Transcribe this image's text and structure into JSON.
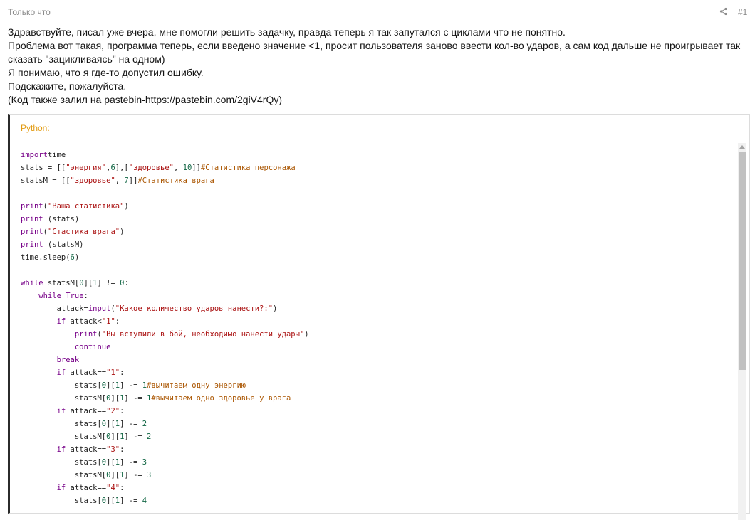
{
  "post": {
    "time": "Только что",
    "number": "#1",
    "paragraphs": [
      "Здравствуйте, писал уже вчера, мне помогли решить задачку, правда теперь я так запутался с циклами что не понятно.",
      "Проблема вот такая, программа теперь, если введено значение <1, просит пользователя заново ввести кол-во ударов, а сам код дальше не проигрывает так сказать \"зацикливаясь\" на одном)",
      "Я понимаю, что я где-то допустил ошибку.",
      "Подскажите, пожалуйста.",
      "(Код также залил на pastebin-https://pastebin.com/2giV4rQy)"
    ]
  },
  "code": {
    "language": "Python:",
    "lines": [
      [
        [
          "kw",
          "import"
        ],
        [
          "",
          "time"
        ]
      ],
      [
        [
          "",
          "stats = [["
        ],
        [
          "st",
          "\"энергия\""
        ],
        [
          "",
          ","
        ],
        [
          "nu",
          "6"
        ],
        [
          "",
          "],["
        ],
        [
          "st",
          "\"здоровье\""
        ],
        [
          "",
          ", "
        ],
        [
          "nu",
          "10"
        ],
        [
          "",
          "]]"
        ],
        [
          "cm",
          "#Статистика персонажа"
        ]
      ],
      [
        [
          "",
          "statsM = [["
        ],
        [
          "st",
          "\"здоровье\""
        ],
        [
          "",
          ", "
        ],
        [
          "nu",
          "7"
        ],
        [
          "",
          "]]"
        ],
        [
          "cm",
          "#Статистика врага"
        ]
      ],
      [],
      [
        [
          "kw",
          "print"
        ],
        [
          "",
          "("
        ],
        [
          "st",
          "\"Ваша статистика\""
        ],
        [
          "",
          ")"
        ]
      ],
      [
        [
          "kw",
          "print"
        ],
        [
          "",
          " (stats)"
        ]
      ],
      [
        [
          "kw",
          "print"
        ],
        [
          "",
          "("
        ],
        [
          "st",
          "\"Стастика врага\""
        ],
        [
          "",
          ")"
        ]
      ],
      [
        [
          "kw",
          "print"
        ],
        [
          "",
          " (statsM)"
        ]
      ],
      [
        [
          "",
          "time.sleep("
        ],
        [
          "nu",
          "6"
        ],
        [
          "",
          ")"
        ]
      ],
      [],
      [
        [
          "kw",
          "while"
        ],
        [
          "",
          " statsM["
        ],
        [
          "nu",
          "0"
        ],
        [
          "",
          "]["
        ],
        [
          "nu",
          "1"
        ],
        [
          "",
          "] != "
        ],
        [
          "nu",
          "0"
        ],
        [
          "",
          ":"
        ]
      ],
      [
        [
          "",
          "    "
        ],
        [
          "kw",
          "while"
        ],
        [
          "",
          ""
        ],
        [
          "kw",
          " True"
        ],
        [
          "",
          ":"
        ]
      ],
      [
        [
          "",
          "        attack="
        ],
        [
          "kw",
          "input"
        ],
        [
          "",
          "("
        ],
        [
          "st",
          "\"Какое количество ударов нанести?:\""
        ],
        [
          "",
          ")"
        ]
      ],
      [
        [
          "",
          "        "
        ],
        [
          "kw",
          "if"
        ],
        [
          "",
          " attack<"
        ],
        [
          "st",
          "\"1\""
        ],
        [
          "",
          ":"
        ]
      ],
      [
        [
          "",
          "            "
        ],
        [
          "kw",
          "print"
        ],
        [
          "",
          "("
        ],
        [
          "st",
          "\"Вы вступили в бой, необходимо нанести удары\""
        ],
        [
          "",
          ")"
        ]
      ],
      [
        [
          "",
          "            "
        ],
        [
          "kw",
          "continue"
        ]
      ],
      [
        [
          "",
          "        "
        ],
        [
          "kw",
          "break"
        ]
      ],
      [
        [
          "",
          "        "
        ],
        [
          "kw",
          "if"
        ],
        [
          "",
          " attack=="
        ],
        [
          "st",
          "\"1\""
        ],
        [
          "",
          ":"
        ]
      ],
      [
        [
          "",
          "            stats["
        ],
        [
          "nu",
          "0"
        ],
        [
          "",
          "]["
        ],
        [
          "nu",
          "1"
        ],
        [
          "",
          "] -= "
        ],
        [
          "nu",
          "1"
        ],
        [
          "cm",
          "#вычитаем одну энергию"
        ]
      ],
      [
        [
          "",
          "            statsM["
        ],
        [
          "nu",
          "0"
        ],
        [
          "",
          "]["
        ],
        [
          "nu",
          "1"
        ],
        [
          "",
          "] -= "
        ],
        [
          "nu",
          "1"
        ],
        [
          "cm",
          "#вычитаем одно здоровье у врага"
        ]
      ],
      [
        [
          "",
          "        "
        ],
        [
          "kw",
          "if"
        ],
        [
          "",
          " attack=="
        ],
        [
          "st",
          "\"2\""
        ],
        [
          "",
          ":"
        ]
      ],
      [
        [
          "",
          "            stats["
        ],
        [
          "nu",
          "0"
        ],
        [
          "",
          "]["
        ],
        [
          "nu",
          "1"
        ],
        [
          "",
          "] -= "
        ],
        [
          "nu",
          "2"
        ]
      ],
      [
        [
          "",
          "            statsM["
        ],
        [
          "nu",
          "0"
        ],
        [
          "",
          "]["
        ],
        [
          "nu",
          "1"
        ],
        [
          "",
          "] -= "
        ],
        [
          "nu",
          "2"
        ]
      ],
      [
        [
          "",
          "        "
        ],
        [
          "kw",
          "if"
        ],
        [
          "",
          " attack=="
        ],
        [
          "st",
          "\"3\""
        ],
        [
          "",
          ":"
        ]
      ],
      [
        [
          "",
          "            stats["
        ],
        [
          "nu",
          "0"
        ],
        [
          "",
          "]["
        ],
        [
          "nu",
          "1"
        ],
        [
          "",
          "] -= "
        ],
        [
          "nu",
          "3"
        ]
      ],
      [
        [
          "",
          "            statsM["
        ],
        [
          "nu",
          "0"
        ],
        [
          "",
          "]["
        ],
        [
          "nu",
          "1"
        ],
        [
          "",
          "] -= "
        ],
        [
          "nu",
          "3"
        ]
      ],
      [
        [
          "",
          "        "
        ],
        [
          "kw",
          "if"
        ],
        [
          "",
          " attack=="
        ],
        [
          "st",
          "\"4\""
        ],
        [
          "",
          ":"
        ]
      ],
      [
        [
          "",
          "            stats["
        ],
        [
          "nu",
          "0"
        ],
        [
          "",
          "]["
        ],
        [
          "nu",
          "1"
        ],
        [
          "",
          "] -= "
        ],
        [
          "nu",
          "4"
        ]
      ]
    ]
  },
  "icons": {
    "share": "share-icon"
  }
}
